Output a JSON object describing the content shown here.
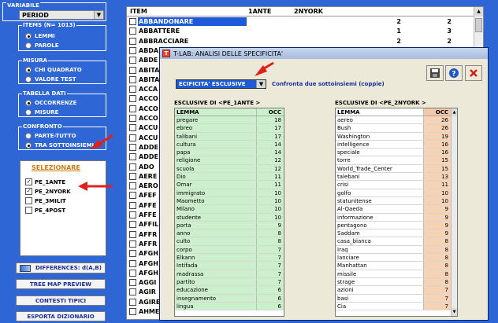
{
  "sidebar": {
    "variabile_label": "VARIABILE",
    "variabile_value": "PERIOD",
    "items_label": "ITEMS (N= 1013)",
    "items_options": [
      "LEMMI",
      "PAROLE"
    ],
    "misura_label": "MISURA",
    "misura_options": [
      "CHI QUADRATO",
      "VALORE TEST"
    ],
    "tabella_label": "TABELLA DATI",
    "tabella_options": [
      "OCCORRENZE",
      "MISURE"
    ],
    "confronto_label": "CONFRONTO",
    "confronto_options": [
      "PARTE-TUTTO",
      "TRA SOTTOINSIEMI"
    ],
    "selezionare_label": "SELEZIONARE",
    "subsets": [
      {
        "label": "PE_1ANTE",
        "checked": "✓"
      },
      {
        "label": "PE_2NYORK",
        "checked": "✓"
      },
      {
        "label": "PE_3MILIT",
        "checked": ""
      },
      {
        "label": "PE_4POST",
        "checked": ""
      }
    ],
    "differences_label": "DIFFERENCES: d(A,B)",
    "btn_treemap": "TREE MAP PREVIEW",
    "btn_contesti": "CONTESTI TIPICI",
    "btn_esporta": "ESPORTA DIZIONARIO"
  },
  "main_table": {
    "headers": [
      "ITEM",
      "1ANTE",
      "2NYORK"
    ],
    "rows": [
      {
        "item": "ABBANDONARE",
        "a": "2",
        "b": "2"
      },
      {
        "item": "ABBATTERE",
        "a": "1",
        "b": "3"
      },
      {
        "item": "ABBRACCIARE",
        "a": "2",
        "b": "2"
      },
      {
        "item": "ABDA",
        "a": "",
        "b": ""
      },
      {
        "item": "ABDE",
        "a": "",
        "b": ""
      },
      {
        "item": "ABITA",
        "a": "",
        "b": ""
      },
      {
        "item": "ABITA",
        "a": "",
        "b": ""
      },
      {
        "item": "ACCA",
        "a": "",
        "b": ""
      },
      {
        "item": "ACCO",
        "a": "",
        "b": ""
      },
      {
        "item": "ACCO",
        "a": "",
        "b": ""
      },
      {
        "item": "ACCO",
        "a": "",
        "b": ""
      },
      {
        "item": "ACCU",
        "a": "",
        "b": ""
      },
      {
        "item": "ACCU",
        "a": "",
        "b": ""
      },
      {
        "item": "ADDE",
        "a": "",
        "b": ""
      },
      {
        "item": "ADDE",
        "a": "",
        "b": ""
      },
      {
        "item": "ADO",
        "a": "",
        "b": ""
      },
      {
        "item": "AERE",
        "a": "",
        "b": ""
      },
      {
        "item": "AERO",
        "a": "",
        "b": ""
      },
      {
        "item": "AFEF",
        "a": "",
        "b": ""
      },
      {
        "item": "AFFE",
        "a": "",
        "b": ""
      },
      {
        "item": "AFFE",
        "a": "",
        "b": ""
      },
      {
        "item": "AFFIL",
        "a": "",
        "b": ""
      },
      {
        "item": "AFFR",
        "a": "",
        "b": ""
      },
      {
        "item": "AFFR",
        "a": "",
        "b": ""
      },
      {
        "item": "AFGH",
        "a": "",
        "b": ""
      },
      {
        "item": "AFGH",
        "a": "",
        "b": ""
      },
      {
        "item": "AFGH",
        "a": "",
        "b": ""
      },
      {
        "item": "AGGI",
        "a": "",
        "b": ""
      },
      {
        "item": "AGIR",
        "a": "",
        "b": ""
      },
      {
        "item": "AGIRE",
        "a": "",
        "b": ""
      },
      {
        "item": "AHME",
        "a": "",
        "b": ""
      }
    ]
  },
  "dialog": {
    "title": "T-LAB: ANALISI DELLE SPECIFICITA'",
    "combo_value": "ECIFICITA' ESCLUSIVE",
    "confronta_label": "Confronta due sottoinsiemi  (coppie)",
    "left_title": "ESCLUSIVE DI <PE_1ANTE >",
    "right_title": "ESCLUSIVE DI <PE_2NYORK >",
    "col_lemma": "LEMMA",
    "col_occ": "OCC",
    "left_rows": [
      [
        "pregare",
        "18"
      ],
      [
        "ebreo",
        "17"
      ],
      [
        "talibani",
        "17"
      ],
      [
        "cultura",
        "14"
      ],
      [
        "papa",
        "14"
      ],
      [
        "religione",
        "12"
      ],
      [
        "scuola",
        "12"
      ],
      [
        "Dio",
        "11"
      ],
      [
        "Omar",
        "11"
      ],
      [
        "immigrato",
        "10"
      ],
      [
        "Maometto",
        "10"
      ],
      [
        "Milano",
        "10"
      ],
      [
        "studente",
        "10"
      ],
      [
        "porta",
        "9"
      ],
      [
        "anno",
        "8"
      ],
      [
        "culto",
        "8"
      ],
      [
        "corpo",
        "7"
      ],
      [
        "Elkann",
        "7"
      ],
      [
        "Intifada",
        "7"
      ],
      [
        "madrassa",
        "7"
      ],
      [
        "partito",
        "7"
      ],
      [
        "educazione",
        "6"
      ],
      [
        "insegnamento",
        "6"
      ],
      [
        "lingua",
        "6"
      ]
    ],
    "right_rows": [
      [
        "aereo",
        "26"
      ],
      [
        "Bush",
        "26"
      ],
      [
        "Washington",
        "19"
      ],
      [
        "intelligence",
        "16"
      ],
      [
        "speciale",
        "16"
      ],
      [
        "torre",
        "15"
      ],
      [
        "World_Trade_Center",
        "15"
      ],
      [
        "talebani",
        "13"
      ],
      [
        "crisi",
        "11"
      ],
      [
        "golfo",
        "10"
      ],
      [
        "statunitense",
        "10"
      ],
      [
        "Al-Qaeda",
        "9"
      ],
      [
        "informazione",
        "9"
      ],
      [
        "pentagono",
        "9"
      ],
      [
        "Saddam",
        "9"
      ],
      [
        "casa_bianca",
        "8"
      ],
      [
        "Iraq",
        "8"
      ],
      [
        "lanciare",
        "8"
      ],
      [
        "Manhattan",
        "8"
      ],
      [
        "missile",
        "8"
      ],
      [
        "strage",
        "8"
      ],
      [
        "azioni",
        "7"
      ],
      [
        "basi",
        "7"
      ],
      [
        "Cia",
        "7"
      ]
    ]
  },
  "colors": {
    "background": "#2e66d6",
    "selection": "#1c5ad9",
    "left_table_fill": "#ccf0cc",
    "right_occ_fill": "#f6d3b5",
    "arrow": "#e0201a"
  }
}
